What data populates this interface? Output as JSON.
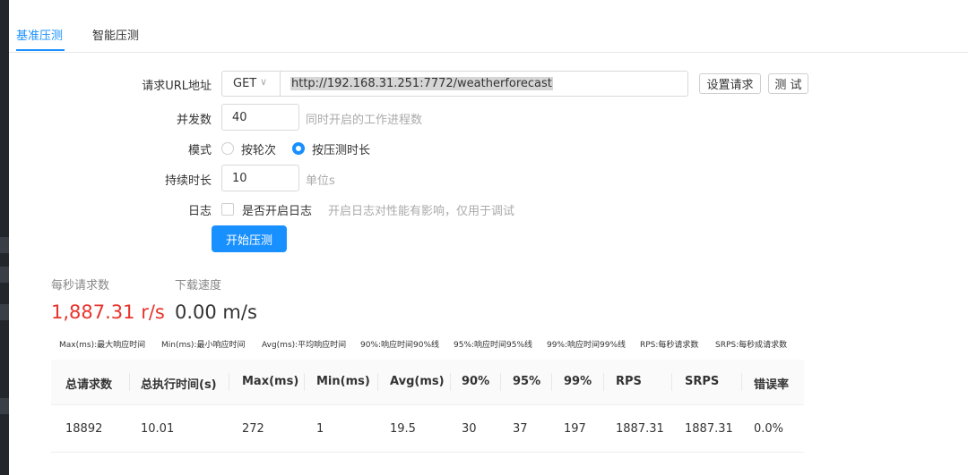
{
  "tabs": [
    {
      "label": "基准压测",
      "active": true
    },
    {
      "label": "智能压测",
      "active": false
    }
  ],
  "form": {
    "url": {
      "label": "请求URL地址",
      "method": "GET",
      "value": "http://192.168.31.251:7772/weatherforecast",
      "settings_button": "设置请求",
      "test_button": "测 试"
    },
    "concurrency": {
      "label": "并发数",
      "value": "40",
      "hint": "同时开启的工作进程数"
    },
    "mode": {
      "label": "模式",
      "options": [
        {
          "label": "按轮次",
          "checked": false
        },
        {
          "label": "按压测时长",
          "checked": true
        }
      ]
    },
    "duration": {
      "label": "持续时长",
      "value": "10",
      "unit": "单位s"
    },
    "log": {
      "label": "日志",
      "checkbox_label": "是否开启日志",
      "checked": false,
      "hint": "开启日志对性能有影响，仅用于调试"
    },
    "start_button": "开始压测"
  },
  "stats": {
    "rps": {
      "label": "每秒请求数",
      "value": "1,887.31 r/s",
      "color": "#e8332b"
    },
    "download": {
      "label": "下载速度",
      "value": "0.00 m/s",
      "color": "#333333"
    }
  },
  "legend": [
    "Max(ms):最大响应时间",
    "Min(ms):最小响应时间",
    "Avg(ms):平均响应时间",
    "90%:响应时间90%线",
    "95%:响应时间95%线",
    "99%:响应时间99%线",
    "RPS:每秒请求数",
    "SRPS:每秒成请求数"
  ],
  "table": {
    "headers": [
      "总请求数",
      "总执行时间(s)",
      "Max(ms)",
      "Min(ms)",
      "Avg(ms)",
      "90%",
      "95%",
      "99%",
      "RPS",
      "SRPS",
      "错误率"
    ],
    "rows": [
      [
        "18892",
        "10.01",
        "272",
        "1",
        "19.5",
        "30",
        "37",
        "197",
        "1887.31",
        "1887.31",
        "0.0%"
      ]
    ]
  },
  "colors": {
    "accent": "#1890ff",
    "rps_red": "#e8332b"
  }
}
